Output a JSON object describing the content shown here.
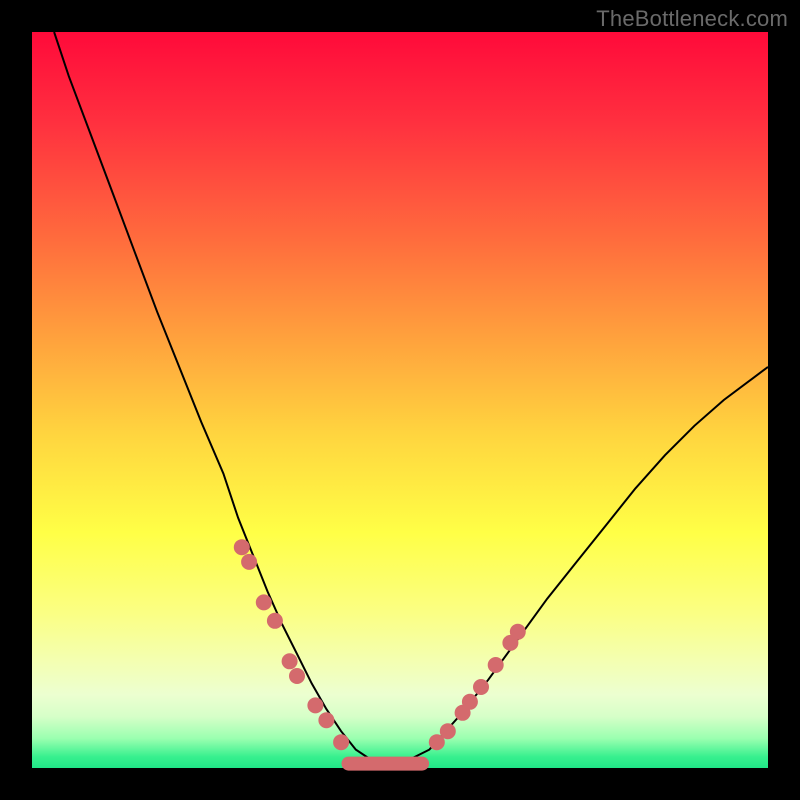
{
  "watermark": "TheBottleneck.com",
  "chart_data": {
    "type": "line",
    "title": "",
    "xlabel": "",
    "ylabel": "",
    "xlim": [
      0,
      100
    ],
    "ylim": [
      0,
      100
    ],
    "series": [
      {
        "name": "bottleneck-curve",
        "x": [
          3,
          5,
          8,
          11,
          14,
          17,
          20,
          23,
          26,
          28,
          30,
          32,
          34,
          36,
          38,
          40,
          42,
          44,
          47,
          50,
          54,
          58,
          62,
          66,
          70,
          74,
          78,
          82,
          86,
          90,
          94,
          98,
          100
        ],
        "y": [
          100,
          94,
          86,
          78,
          70,
          62,
          54.5,
          47,
          40,
          34,
          29,
          24,
          19.5,
          15.5,
          11.5,
          8,
          5,
          2.5,
          0.5,
          0.5,
          2.5,
          7,
          12,
          17.5,
          23,
          28,
          33,
          38,
          42.5,
          46.5,
          50,
          53,
          54.5
        ]
      }
    ],
    "markers": {
      "name": "highlight-dots",
      "x": [
        28.5,
        29.5,
        31.5,
        33,
        35,
        36,
        38.5,
        40,
        42,
        55,
        56.5,
        58.5,
        59.5,
        61,
        63,
        65,
        66
      ],
      "y": [
        30,
        28,
        22.5,
        20,
        14.5,
        12.5,
        8.5,
        6.5,
        3.5,
        3.5,
        5,
        7.5,
        9,
        11,
        14,
        17,
        18.5
      ]
    },
    "flat_segment": {
      "x0": 43,
      "x1": 53,
      "y": 0.6
    },
    "background_gradient": {
      "top": "#ff0a3a",
      "mid": "#ffff46",
      "bottom": "#20e687"
    }
  }
}
